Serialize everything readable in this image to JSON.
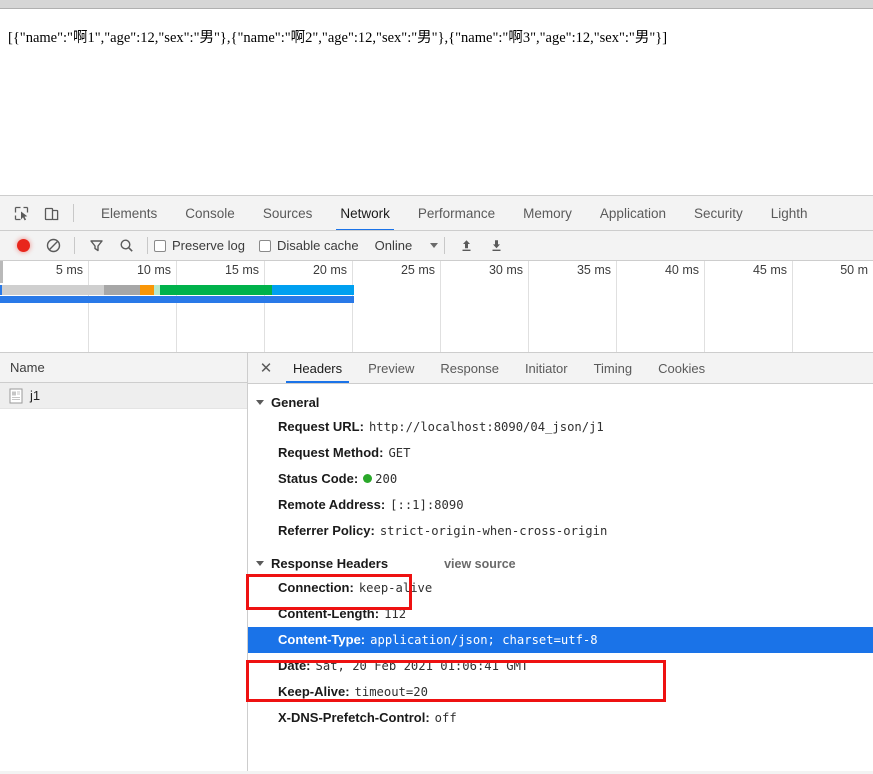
{
  "page": {
    "json_response": "[{\"name\":\"啊1\",\"age\":12,\"sex\":\"男\"},{\"name\":\"啊2\",\"age\":12,\"sex\":\"男\"},{\"name\":\"啊3\",\"age\":12,\"sex\":\"男\"}]"
  },
  "devtools": {
    "main_tabs": [
      {
        "label": "Elements",
        "active": false
      },
      {
        "label": "Console",
        "active": false
      },
      {
        "label": "Sources",
        "active": false
      },
      {
        "label": "Network",
        "active": true
      },
      {
        "label": "Performance",
        "active": false
      },
      {
        "label": "Memory",
        "active": false
      },
      {
        "label": "Application",
        "active": false
      },
      {
        "label": "Security",
        "active": false
      },
      {
        "label": "Lighth",
        "active": false
      }
    ],
    "icons": {
      "inspect": "inspect-element-icon",
      "device": "device-toolbar-icon",
      "record": "record-icon",
      "clear": "clear-icon",
      "filter": "filter-icon",
      "search": "search-icon",
      "import": "import-har-icon",
      "export": "export-har-icon"
    },
    "network_toolbar": {
      "preserve_log_label": "Preserve log",
      "preserve_log_checked": false,
      "disable_cache_label": "Disable cache",
      "disable_cache_checked": false,
      "throttling_value": "Online"
    },
    "overview": {
      "ticks": [
        "5 ms",
        "10 ms",
        "15 ms",
        "20 ms",
        "25 ms",
        "30 ms",
        "35 ms",
        "40 ms",
        "45 ms",
        "50 m"
      ]
    },
    "request_list": {
      "column_header": "Name",
      "rows": [
        {
          "name": "j1",
          "icon": "document-icon",
          "selected": true
        }
      ]
    },
    "detail_tabs": [
      {
        "label": "Headers",
        "active": true
      },
      {
        "label": "Preview",
        "active": false
      },
      {
        "label": "Response",
        "active": false
      },
      {
        "label": "Initiator",
        "active": false
      },
      {
        "label": "Timing",
        "active": false
      },
      {
        "label": "Cookies",
        "active": false
      }
    ],
    "close_icon": "close-icon",
    "sections": {
      "general": {
        "title": "General",
        "rows": [
          {
            "key": "Request URL:",
            "value": "http://localhost:8090/04_json/j1"
          },
          {
            "key": "Request Method:",
            "value": "GET"
          },
          {
            "key": "Status Code:",
            "value": "200",
            "status_dot": "#2aa82a"
          },
          {
            "key": "Remote Address:",
            "value": "[::1]:8090"
          },
          {
            "key": "Referrer Policy:",
            "value": "strict-origin-when-cross-origin"
          }
        ]
      },
      "response_headers": {
        "title": "Response Headers",
        "view_source": "view source",
        "rows": [
          {
            "key": "Connection:",
            "value": "keep-alive"
          },
          {
            "key": "Content-Length:",
            "value": "112"
          },
          {
            "key": "Content-Type:",
            "value": "application/json; charset=utf-8",
            "selected": true
          },
          {
            "key": "Date:",
            "value": "Sat, 20 Feb 2021 01:06:41 GMT"
          },
          {
            "key": "Keep-Alive:",
            "value": "timeout=20"
          },
          {
            "key": "X-DNS-Prefetch-Control:",
            "value": "off"
          }
        ]
      }
    }
  },
  "annotations": {
    "highlight_color": "#ee1111",
    "selected_row_color": "#1a73e8"
  }
}
